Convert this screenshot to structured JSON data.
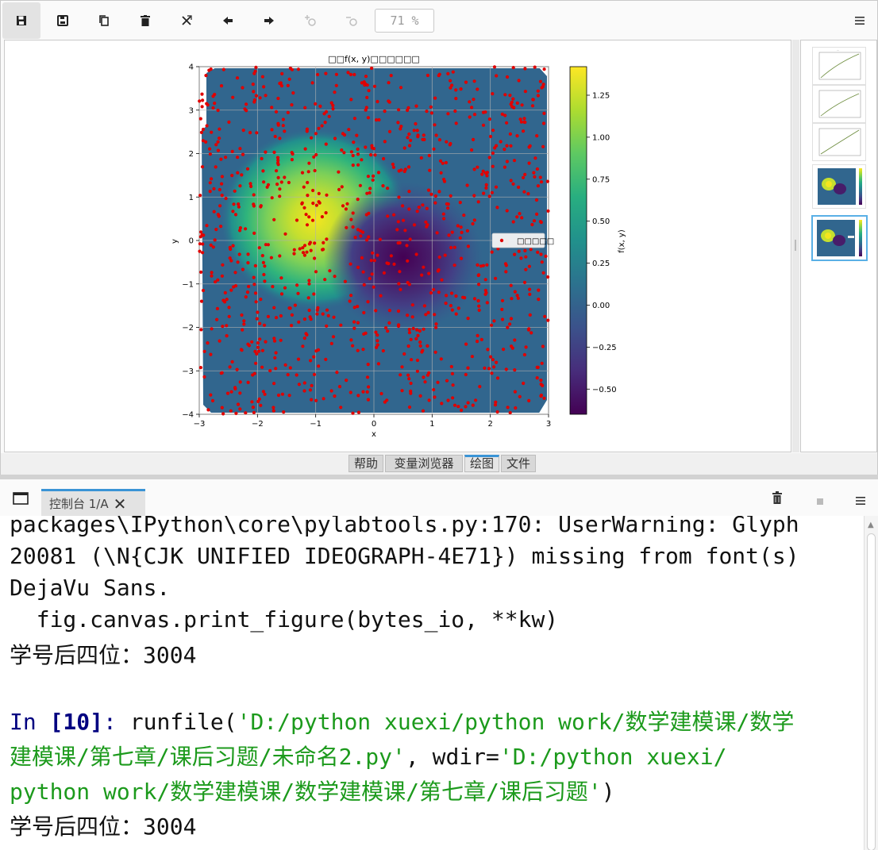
{
  "toolbar": {
    "zoom": "71 %",
    "icons": [
      "save-icon",
      "save-all-icon",
      "copy-icon",
      "trash-icon",
      "clear-all-icon",
      "arrow-left-icon",
      "arrow-right-icon",
      "zoom-in-icon",
      "zoom-out-icon",
      "menu-icon"
    ]
  },
  "figure": {
    "title": "□□f(x, y)□□□□□□",
    "legend_label": "□□□□□",
    "colorbar_label": "f(x, y)"
  },
  "chart_data": {
    "type": "heatmap",
    "title": "□□f(x, y)□□□□□□",
    "xlabel": "x",
    "ylabel": "y",
    "xlim": [
      -3,
      3
    ],
    "ylim": [
      -4,
      4
    ],
    "x_ticks": [
      "−3",
      "−2",
      "−1",
      "0",
      "1",
      "2",
      "3"
    ],
    "y_ticks": [
      "−4",
      "−3",
      "−2",
      "−1",
      "0",
      "1",
      "2",
      "3",
      "4"
    ],
    "grid": true,
    "colormap": "viridis",
    "colorbar": {
      "label": "f(x, y)",
      "range": [
        -0.65,
        1.42
      ],
      "ticks": [
        "−0.50",
        "−0.25",
        "0.00",
        "0.25",
        "0.50",
        "0.75",
        "1.00",
        "1.25"
      ]
    },
    "peak": {
      "x": -1.0,
      "y": 0.6,
      "value": 1.42
    },
    "trough": {
      "x": 0.6,
      "y": -0.3,
      "value": -0.62
    },
    "scatter": {
      "name": "□□□□□",
      "color": "#e00000",
      "count": 1000
    },
    "legend_position": "center-right"
  },
  "pane_tabs": [
    "帮助",
    "变量浏览器",
    "绘图",
    "文件"
  ],
  "console": {
    "tab_label": "控制台 1/A",
    "lines": [
      "packages\\IPython\\core\\pylabtools.py:170: UserWarning: Glyph",
      "20081 (\\N{CJK UNIFIED IDEOGRAPH-4E71}) missing from font(s)",
      "DejaVu Sans.",
      "  fig.canvas.print_figure(bytes_io, **kw)",
      "学号后四位：3004"
    ],
    "prompt_in": "In ",
    "prompt_num": "[10]",
    "prompt_colon": ": ",
    "runfile_fn": "runfile(",
    "runfile_str1_line1": "'D:/python xuexi/python work/数学建模课/数学",
    "runfile_str1_line2": "建模课/第七章/课后习题/未命名2.py'",
    "runfile_mid": ", wdir=",
    "runfile_str2_line2": "'D:/python xuexi/",
    "runfile_str2_line3": "python work/数学建模课/数学建模课/第七章/课后习题'",
    "runfile_end": ")",
    "output_final": "学号后四位：3004"
  }
}
